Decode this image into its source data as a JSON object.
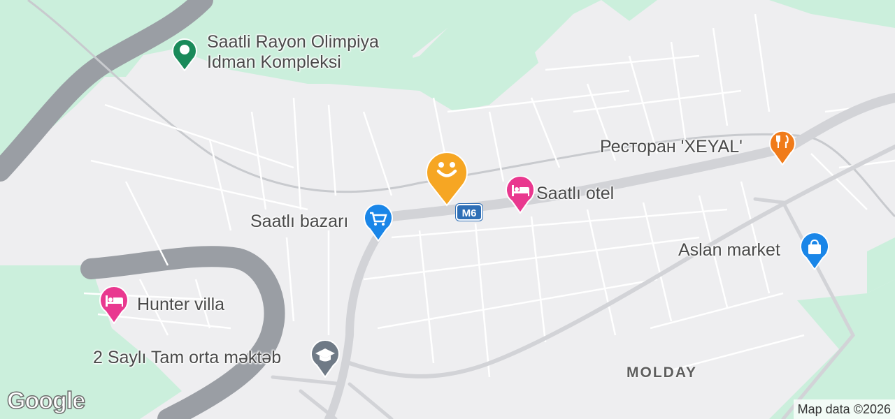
{
  "map": {
    "colors": {
      "land": "#eeeef0",
      "park": "#cbefdc",
      "river": "#9a9ea4",
      "road": "#ffffff",
      "highway": "#d4d5d9",
      "railway": "#c4c6ca"
    },
    "route_shield": "M6",
    "area_label": "MOLDAY",
    "places": [
      {
        "name": "Saatli Rayon Olimpiya\nIdman Kompleksi",
        "icon": "sports-complex-icon",
        "color": "#1a8a5a"
      },
      {
        "name": "Ресторан 'XEYAL'",
        "icon": "restaurant-icon",
        "color": "#f07b1a"
      },
      {
        "name": "Saatlı otel",
        "icon": "hotel-icon",
        "color": "#e9388f"
      },
      {
        "name": "Saatlı bazarı",
        "icon": "shopping-cart-icon",
        "color": "#1a86e8"
      },
      {
        "name": "Aslan market",
        "icon": "shopping-bag-icon",
        "color": "#1a86e8"
      },
      {
        "name": "Hunter villa",
        "icon": "hotel-icon",
        "color": "#e9388f"
      },
      {
        "name": "2 Saylı Tam orta məktəb",
        "icon": "school-icon",
        "color": "#6f7a86"
      }
    ],
    "selected_pin": {
      "icon": "smiley-icon",
      "color": "#f6a623"
    },
    "logo": "Google",
    "attribution": "Map data ©2026"
  }
}
